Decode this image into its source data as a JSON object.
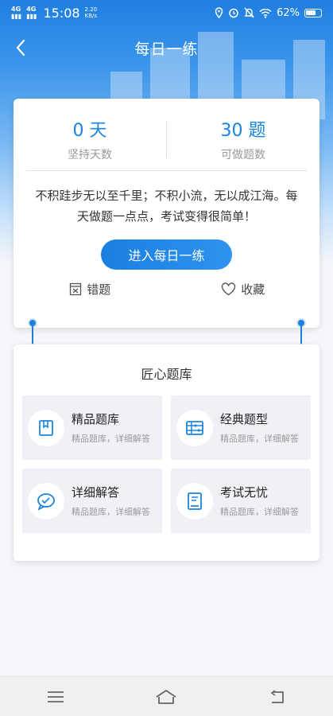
{
  "status_bar": {
    "network1": "4G",
    "network2": "4G",
    "time": "15:08",
    "speed": "2.20",
    "speed_unit": "KB/s",
    "battery": "62%"
  },
  "header": {
    "title": "每日一练"
  },
  "summary": {
    "days_value": "0 天",
    "days_label": "坚持天数",
    "questions_value": "30 题",
    "questions_label": "可做题数",
    "motto": "不积跬步无以至千里；不积小流，无以成江海。每天做题一点点，考试变得很简单！",
    "enter_label": "进入每日一练",
    "wrong_label": "错题",
    "favorite_label": "收藏"
  },
  "bank": {
    "title": "匠心题库",
    "items": [
      {
        "title": "精品题库",
        "subtitle": "精品题库，详细解答",
        "icon": "book-icon"
      },
      {
        "title": "经典题型",
        "subtitle": "精品题库，详细解答",
        "icon": "abacus-icon"
      },
      {
        "title": "详细解答",
        "subtitle": "精品题库，详细解答",
        "icon": "chat-check-icon"
      },
      {
        "title": "考试无忧",
        "subtitle": "精品题库，详细解答",
        "icon": "exam-score-icon"
      }
    ]
  },
  "colors": {
    "accent": "#1b84df",
    "header_blue": "#1f7ee0"
  }
}
